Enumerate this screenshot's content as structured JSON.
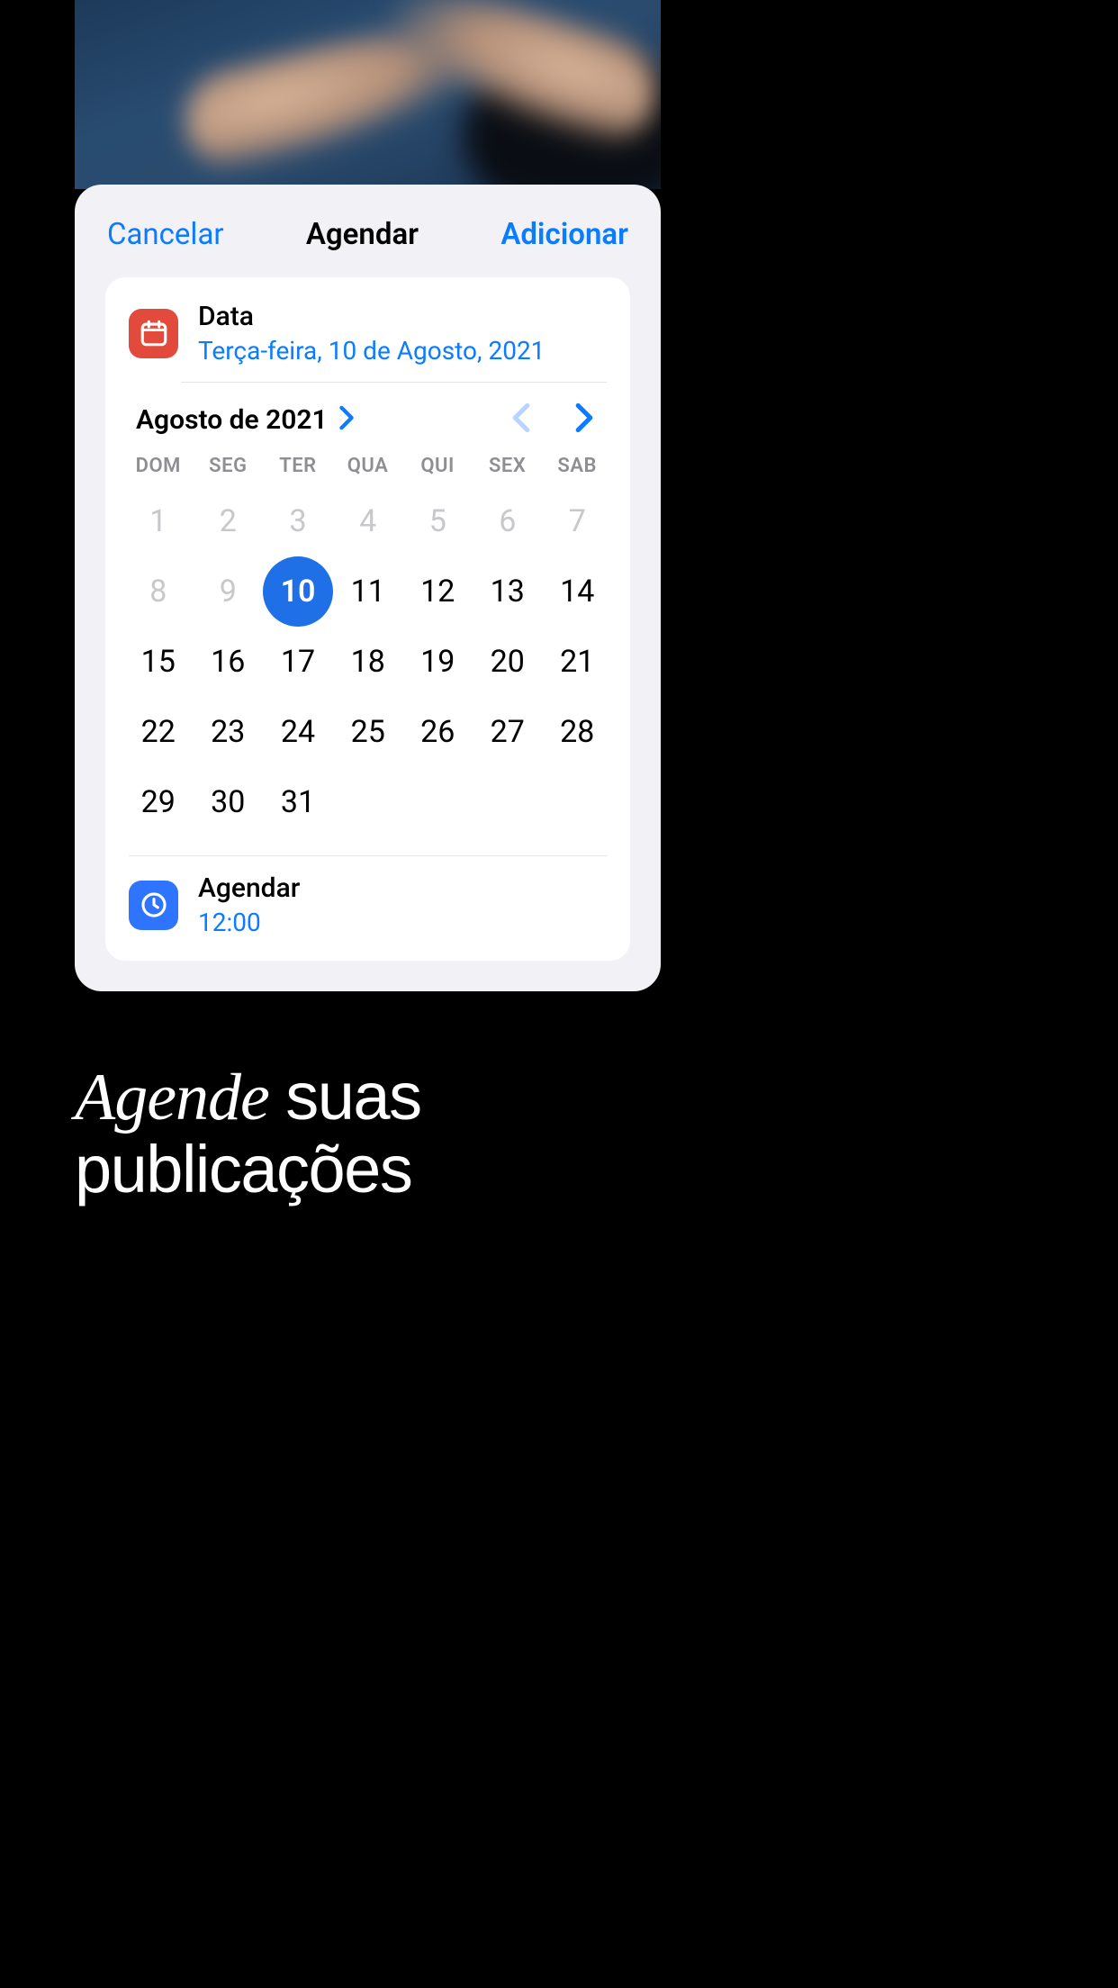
{
  "sheet": {
    "cancel_label": "Cancelar",
    "title": "Agendar",
    "add_label": "Adicionar"
  },
  "date_section": {
    "title": "Data",
    "value": "Terça-feira, 10 de Agosto, 2021"
  },
  "calendar": {
    "month_label": "Agosto de 2021",
    "weekdays": [
      "DOM",
      "SEG",
      "TER",
      "QUA",
      "QUI",
      "SEX",
      "SAB"
    ],
    "weeks": [
      [
        {
          "n": 1,
          "muted": true
        },
        {
          "n": 2,
          "muted": true
        },
        {
          "n": 3,
          "muted": true
        },
        {
          "n": 4,
          "muted": true
        },
        {
          "n": 5,
          "muted": true
        },
        {
          "n": 6,
          "muted": true
        },
        {
          "n": 7,
          "muted": true
        }
      ],
      [
        {
          "n": 8,
          "muted": true
        },
        {
          "n": 9,
          "muted": true
        },
        {
          "n": 10,
          "selected": true
        },
        {
          "n": 11
        },
        {
          "n": 12
        },
        {
          "n": 13
        },
        {
          "n": 14
        }
      ],
      [
        {
          "n": 15
        },
        {
          "n": 16
        },
        {
          "n": 17
        },
        {
          "n": 18
        },
        {
          "n": 19
        },
        {
          "n": 20
        },
        {
          "n": 21
        }
      ],
      [
        {
          "n": 22
        },
        {
          "n": 23
        },
        {
          "n": 24
        },
        {
          "n": 25
        },
        {
          "n": 26
        },
        {
          "n": 27
        },
        {
          "n": 28
        }
      ],
      [
        {
          "n": 29
        },
        {
          "n": 30
        },
        {
          "n": 31
        },
        null,
        null,
        null,
        null
      ]
    ]
  },
  "time_section": {
    "title": "Agendar",
    "value": "12:00"
  },
  "slogan": {
    "word1": "Agende",
    "word2": "suas",
    "word3": "publicações"
  }
}
